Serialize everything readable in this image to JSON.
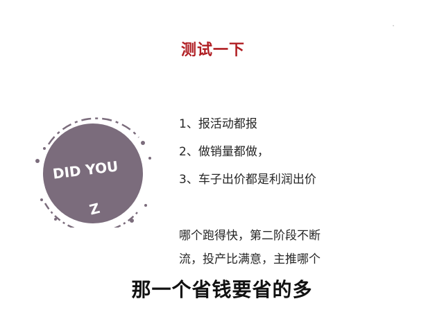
{
  "slide": {
    "title": "测试一下",
    "badge": {
      "text": "DID YOU",
      "mark": "Z",
      "color": "#7b6c7c"
    },
    "list": [
      "1、报活动都报",
      "2、做销量都做，",
      "3、车子出价都是利润出价"
    ],
    "paragraph": [
      "哪个跑得快，第二阶段不断",
      "流，投产比满意，主推哪个"
    ],
    "footer": "那一个省钱要省的多",
    "colors": {
      "title": "#b01e23",
      "text": "#262626"
    }
  }
}
